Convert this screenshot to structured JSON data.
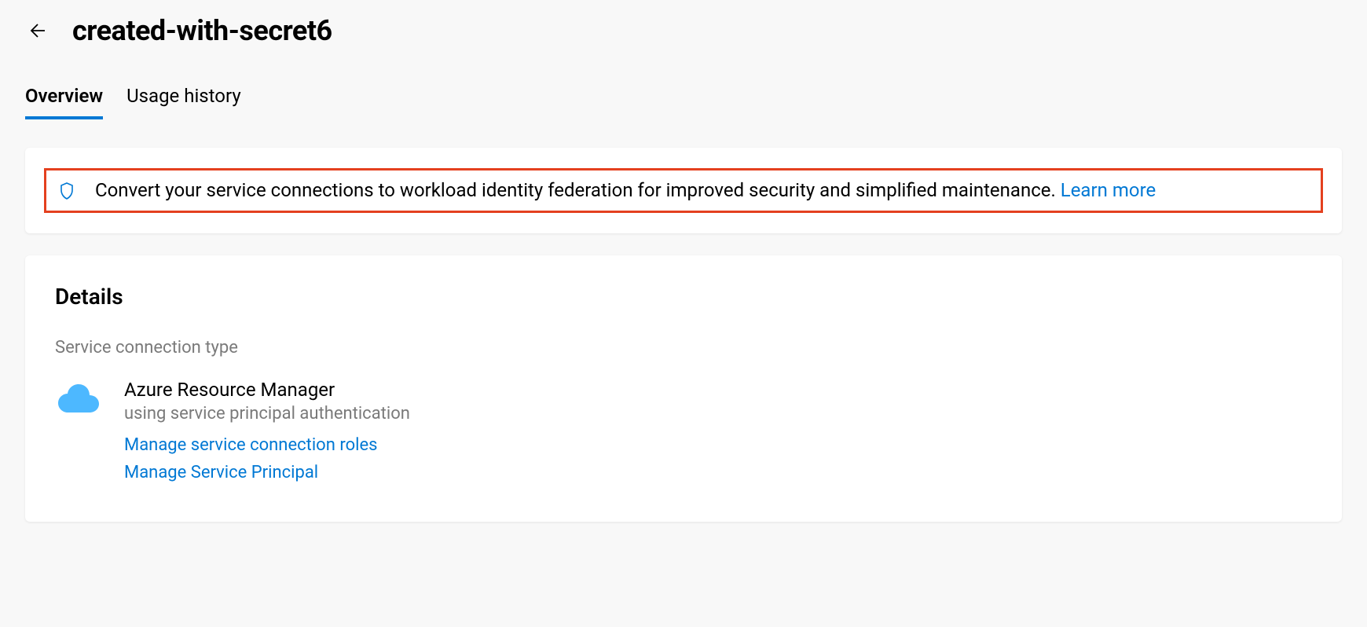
{
  "header": {
    "title": "created-with-secret6"
  },
  "tabs": [
    {
      "label": "Overview",
      "active": true
    },
    {
      "label": "Usage history",
      "active": false
    }
  ],
  "banner": {
    "text": "Convert your service connections to workload identity federation for improved security and simplified maintenance. ",
    "link_label": "Learn more"
  },
  "details": {
    "heading": "Details",
    "field_label": "Service connection type",
    "type_name": "Azure Resource Manager",
    "type_subtext": "using service principal authentication",
    "link_roles": "Manage service connection roles",
    "link_principal": "Manage Service Principal"
  }
}
